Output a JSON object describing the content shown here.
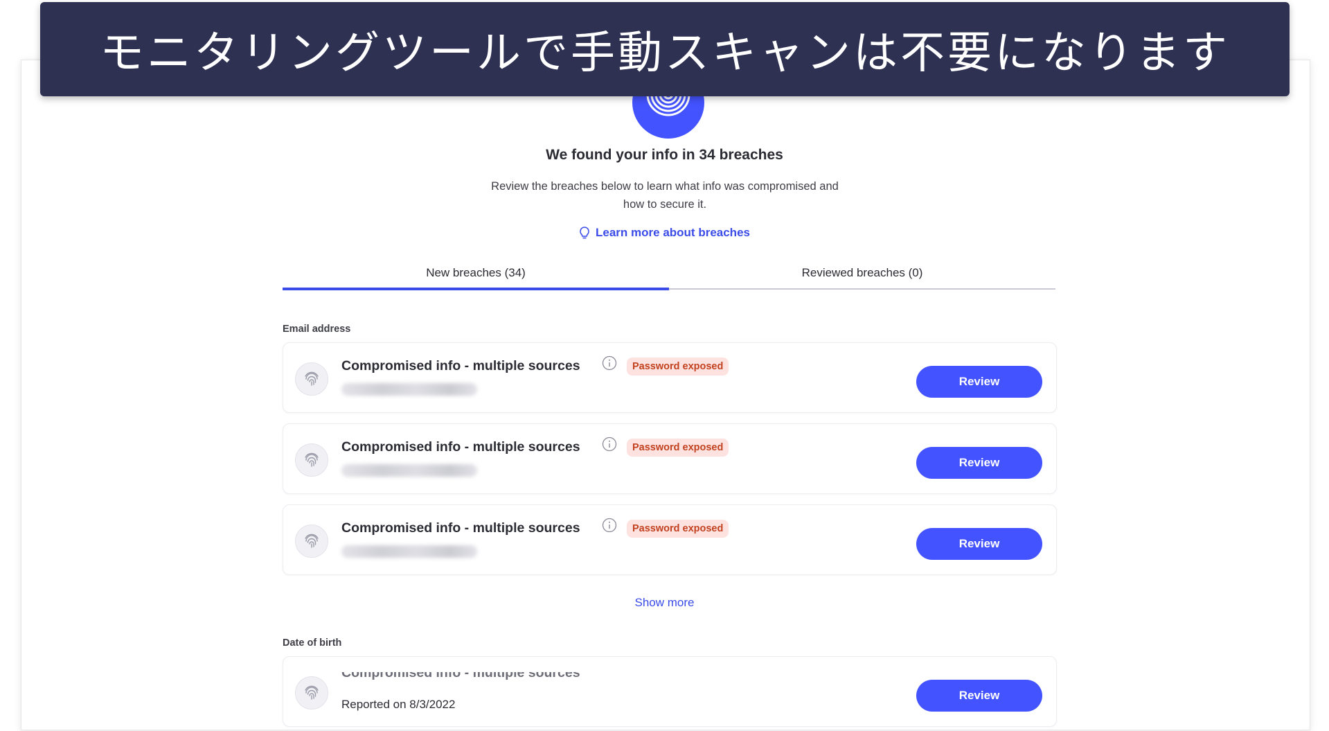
{
  "banner": {
    "caption": "モニタリングツールで手動スキャンは不要になります"
  },
  "hero": {
    "headline": "We found your info in 34 breaches",
    "subline": "Review the breaches below to learn what info was compromised and how to secure it.",
    "learn_more": "Learn more about breaches"
  },
  "tabs": [
    {
      "label": "New breaches (34)",
      "active": true
    },
    {
      "label": "Reviewed breaches (0)",
      "active": false
    }
  ],
  "sections": {
    "email": {
      "label": "Email address",
      "items": [
        {
          "title": "Compromised info - multiple sources",
          "badge": "Password exposed",
          "button": "Review"
        },
        {
          "title": "Compromised info - multiple sources",
          "badge": "Password exposed",
          "button": "Review"
        },
        {
          "title": "Compromised info - multiple sources",
          "badge": "Password exposed",
          "button": "Review"
        }
      ],
      "show_more": "Show more"
    },
    "dob": {
      "label": "Date of birth",
      "items": [
        {
          "title": "Compromised info - multiple sources",
          "reported": "Reported on 8/3/2022",
          "button": "Review"
        }
      ]
    }
  },
  "colors": {
    "accent": "#4353ff",
    "banner_bg": "#2f3153",
    "badge_bg": "#fde2e0",
    "badge_text": "#c2421f"
  },
  "icons": {
    "hero": "fingerprint-icon",
    "learn_more": "lightbulb-icon",
    "card": "fingerprint-icon",
    "info": "info-icon"
  }
}
